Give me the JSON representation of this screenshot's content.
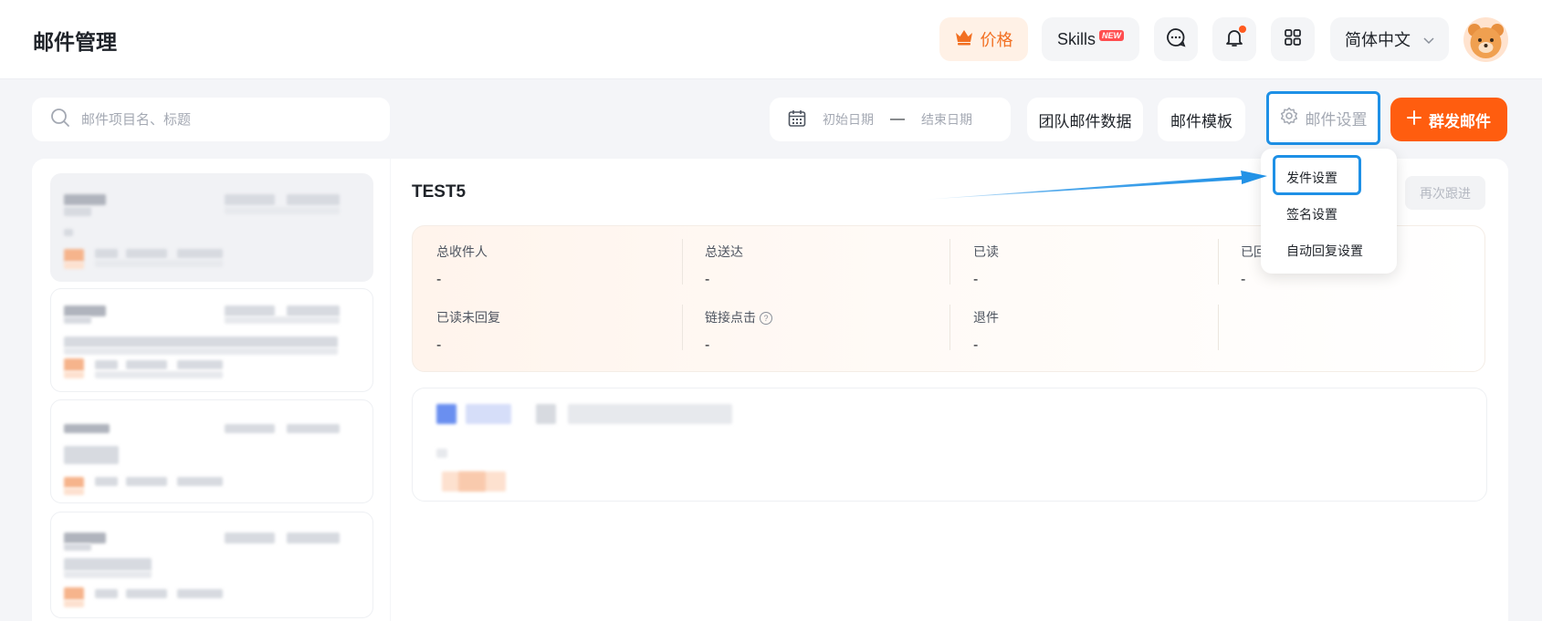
{
  "header": {
    "title": "邮件管理",
    "price_label": "价格",
    "skills_label": "Skills",
    "skills_badge": "NEW",
    "language": "简体中文"
  },
  "toolbar": {
    "search_placeholder": "邮件项目名、标题",
    "start_date_placeholder": "初始日期",
    "date_separator": "—",
    "end_date_placeholder": "结束日期",
    "team_data_label": "团队邮件数据",
    "template_label": "邮件模板",
    "mail_settings_label": "邮件设置",
    "mass_send_label": "群发邮件"
  },
  "detail": {
    "title": "TEST5",
    "follow_up_label": "再次跟进",
    "stats": [
      {
        "label": "总收件人",
        "value": "-"
      },
      {
        "label": "总送达",
        "value": "-"
      },
      {
        "label": "已读",
        "value": "-"
      },
      {
        "label": "已回",
        "value": "-"
      },
      {
        "label": "已读未回复",
        "value": "-"
      },
      {
        "label": "链接点击",
        "value": "-"
      },
      {
        "label": "退件",
        "value": "-"
      }
    ]
  },
  "dropdown": {
    "items": [
      "发件设置",
      "签名设置",
      "自动回复设置"
    ]
  },
  "colors": {
    "accent": "#ff5d0f",
    "highlight": "#1e90e6"
  }
}
